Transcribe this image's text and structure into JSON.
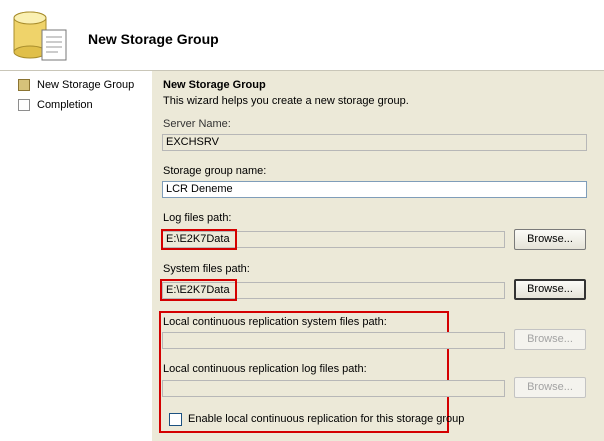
{
  "header": {
    "title": "New Storage Group",
    "icon": "database-storage-icon"
  },
  "sidebar": {
    "items": [
      {
        "label": "New Storage Group",
        "state": "current"
      },
      {
        "label": "Completion",
        "state": "pending"
      }
    ]
  },
  "page": {
    "heading": "New Storage Group",
    "description": "This wizard helps you create a new storage group.",
    "server_name_label": "Server Name:",
    "server_name_value": "EXCHSRV",
    "storage_group_name_label": "Storage group name:",
    "storage_group_name_value": "LCR Deneme",
    "log_files_path_label": "Log files path:",
    "log_files_path_value": "E:\\E2K7Data",
    "log_browse_label": "Browse...",
    "system_files_path_label": "System files path:",
    "system_files_path_value": "E:\\E2K7Data",
    "system_browse_label": "Browse...",
    "lcr_system_files_label": "Local continuous replication system files path:",
    "lcr_system_files_value": "",
    "lcr_system_browse_label": "Browse...",
    "lcr_log_files_label": "Local continuous replication log files path:",
    "lcr_log_files_value": "",
    "lcr_log_browse_label": "Browse...",
    "enable_lcr_label": "Enable local continuous replication for this storage group",
    "enable_lcr_checked": false
  },
  "colors": {
    "highlight": "#d40000",
    "dialog_bg": "#ece9d8"
  }
}
